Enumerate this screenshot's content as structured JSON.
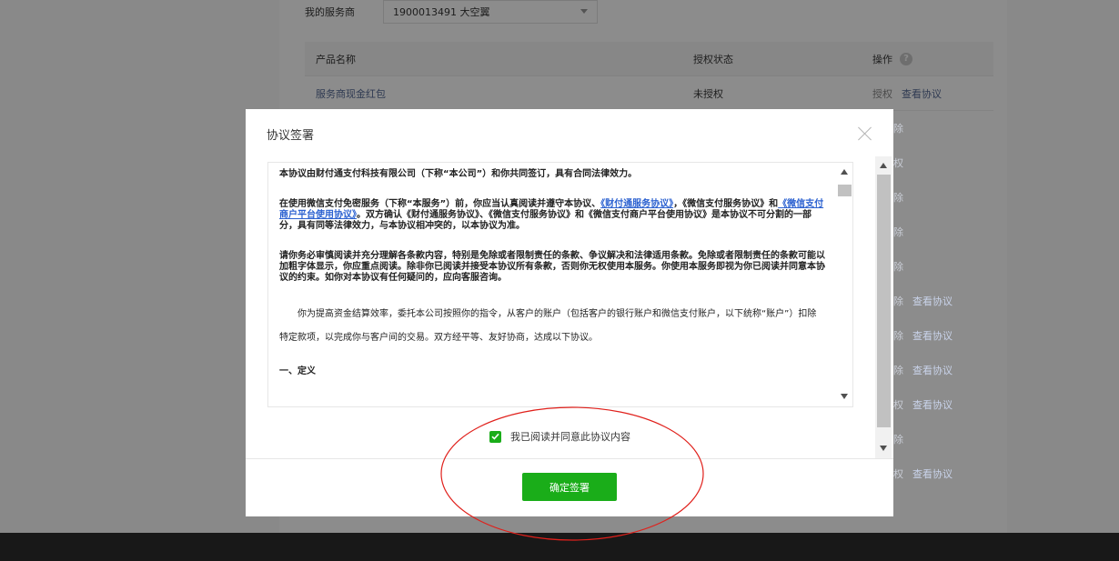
{
  "provider": {
    "label": "我的服务商",
    "selected": "1900013491 大空翼"
  },
  "table": {
    "headers": {
      "name": "产品名称",
      "status": "授权状态",
      "ops": "操作"
    },
    "first_row": {
      "name": "服务商现金红包",
      "status": "未授权",
      "op_authorize": "授权",
      "op_view": "查看协议"
    }
  },
  "side_ops": [
    {
      "part": "除",
      "view": ""
    },
    {
      "part": "权",
      "view": ""
    },
    {
      "part": "除",
      "view": ""
    },
    {
      "part": "除",
      "view": ""
    },
    {
      "part": "除",
      "view": ""
    },
    {
      "part": "除",
      "view": "查看协议"
    },
    {
      "part": "除",
      "view": "查看协议"
    },
    {
      "part": "除",
      "view": "查看协议"
    },
    {
      "part": "权",
      "view": "查看协议"
    },
    {
      "part": "除",
      "view": ""
    },
    {
      "part": "权",
      "view": "查看协议"
    }
  ],
  "modal": {
    "title": "协议签署",
    "doc": {
      "p1": "本协议由财付通支付科技有限公司（下称“本公司”）和你共同签订，具有合同法律效力。",
      "p2_a": "在使用微信支付免密服务（下称“本服务”）前，你应当认真阅读并遵守本协议、",
      "p2_link1": "《财付通服务协议》",
      "p2_b": "，《微信支付服务协议》和",
      "p2_link2": "《微信支付商户平台使用协议》",
      "p2_c": "。双方确认《财付通服务协议》、《微信支付服务协议》和《微信支付商户平台使用协议》是本协议不可分割的一部分，具有同等法律效力，与本协议相冲突的，以本协议为准。",
      "p3": "请你务必审慎阅读并充分理解各条款内容，特别是免除或者限制责任的条款、争议解决和法律适用条款。免除或者限制责任的条款可能以加粗字体显示，你应重点阅读。除非你已阅读并接受本协议所有条款，否则你无权使用本服务。你使用本服务即视为你已阅读并同意本协议的约束。如你对本协议有任何疑问的，应向客服咨询。",
      "p4": "你为提高资金结算效率，委托本公司按照你的指令，从客户的账户（包括客户的银行账户和微信支付账户，以下统称“账户”）扣除特定款项，以完成你与客户间的交易。双方经平等、友好协商，达成以下协议。",
      "p5": "一、定义"
    },
    "agree_label": "我已阅读并同意此协议内容",
    "agree_checked": true,
    "confirm_label": "确定签署"
  },
  "colors": {
    "accent": "#1aad19",
    "link": "#576b95",
    "annotation": "#e0201b"
  }
}
